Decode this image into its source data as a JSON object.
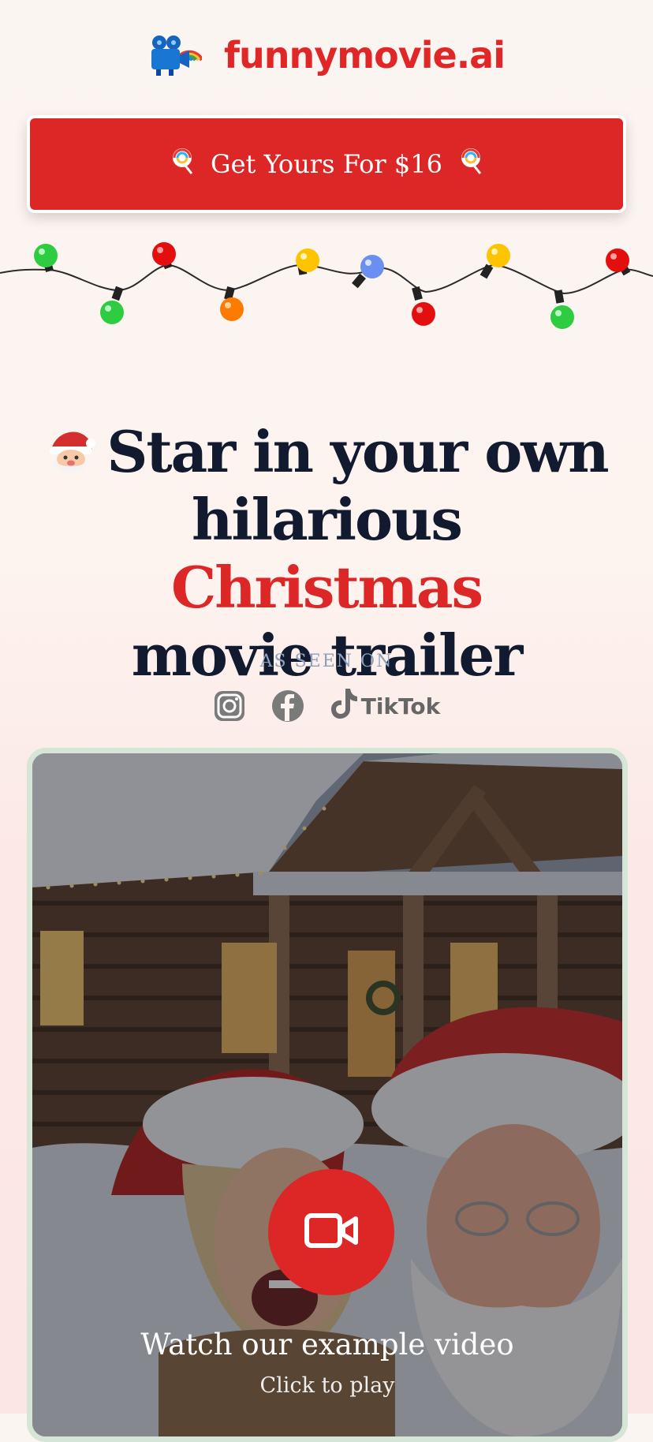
{
  "header": {
    "brand": "funnymovie.ai",
    "logo_icon": "movie-camera-rainbow-icon"
  },
  "cta": {
    "label": "Get Yours For $16",
    "icon": "lollipop-icon",
    "color": "#dd2626"
  },
  "hero": {
    "icon": "santa-emoji-icon",
    "line1": "Star in your own",
    "line2_prefix": "hilarious ",
    "line2_highlight": "Christmas",
    "line3": "movie trailer",
    "highlight_color": "#dd2626"
  },
  "seen_on": {
    "label": "AS SEEN ON",
    "items": [
      {
        "icon": "instagram-icon"
      },
      {
        "icon": "facebook-icon"
      },
      {
        "icon": "tiktok-icon",
        "label": "TikTok"
      }
    ]
  },
  "video": {
    "title": "Watch our example video",
    "subtitle": "Click to play",
    "play_icon": "video-camera-icon",
    "border_color": "#d5e6d6"
  }
}
